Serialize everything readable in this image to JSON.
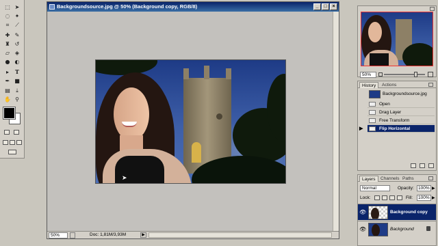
{
  "toolbox": {
    "tools": [
      "marquee",
      "move",
      "lasso",
      "magic-wand",
      "crop",
      "slice",
      "healing-brush",
      "brush",
      "clone-stamp",
      "history-brush",
      "eraser",
      "paint-bucket",
      "blur",
      "dodge",
      "path-selection",
      "type",
      "pen",
      "shape",
      "notes",
      "eyedropper",
      "hand",
      "zoom"
    ],
    "foreground_color": "#000000",
    "background_color": "#ffffff"
  },
  "document": {
    "title": "Backgroundsource.jpg @ 50% (Background copy, RGB/8)",
    "zoom": "50%",
    "doc_info": "Doc: 1,81M/3,93M",
    "titlebar_color": "#0a246a"
  },
  "navigator": {
    "zoom": "50%"
  },
  "history": {
    "tabs": [
      "History",
      "Actions"
    ],
    "snapshot": "Backgroundsource.jpg",
    "states": [
      {
        "label": "Open",
        "selected": false
      },
      {
        "label": "Drag Layer",
        "selected": false
      },
      {
        "label": "Free Transform",
        "selected": false
      },
      {
        "label": "Flip Horizontal",
        "selected": true
      }
    ],
    "selected_color": "#0a246a"
  },
  "layers": {
    "tabs": [
      "Layers",
      "Channels",
      "Paths"
    ],
    "blend_mode": "Normal",
    "opacity_label": "Opacity:",
    "opacity_value": "100%",
    "lock_label": "Lock:",
    "fill_label": "Fill:",
    "fill_value": "100%",
    "items": [
      {
        "name": "Background copy",
        "selected": true,
        "visible": true
      },
      {
        "name": "Background",
        "selected": false,
        "visible": true,
        "locked": true
      }
    ]
  }
}
